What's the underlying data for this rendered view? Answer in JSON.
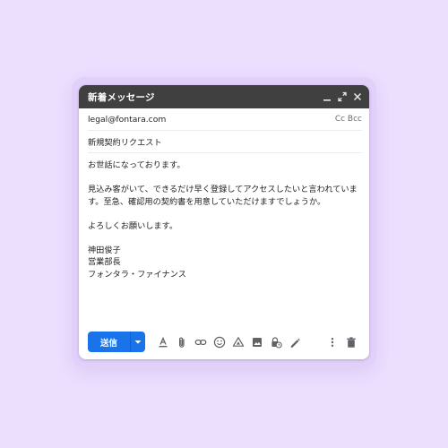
{
  "window": {
    "title": "新着メッセージ"
  },
  "recipient": {
    "to": "legal@fontara.com",
    "cc_bcc_label": "Cc Bcc"
  },
  "subject": "新規契約リクエスト",
  "message": {
    "greeting": "お世話になっております。",
    "paragraph_line_1": "見込み客がいて、できるだけ早く登録してアクセスしたいと言われていま",
    "paragraph_line_2": "す。至急、確認用の契約書を用意していただけますでしょうか。",
    "closing": "よろしくお願いします。",
    "signature_name": "神田俊子",
    "signature_title": "営業部長",
    "signature_company": "フォンタラ・ファイナンス"
  },
  "toolbar": {
    "send_label": "送信",
    "icons": [
      "text-format-icon",
      "attach-icon",
      "link-icon",
      "emoji-icon",
      "drive-icon",
      "image-icon",
      "lock-clock-icon",
      "signature-pen-icon",
      "more-vert-icon",
      "trash-icon"
    ]
  },
  "colors": {
    "page_background": "#ecdffe",
    "frame": "#e1d0fa",
    "titlebar": "#404040",
    "send_button": "#1a73e8",
    "icon": "#5f6368"
  }
}
